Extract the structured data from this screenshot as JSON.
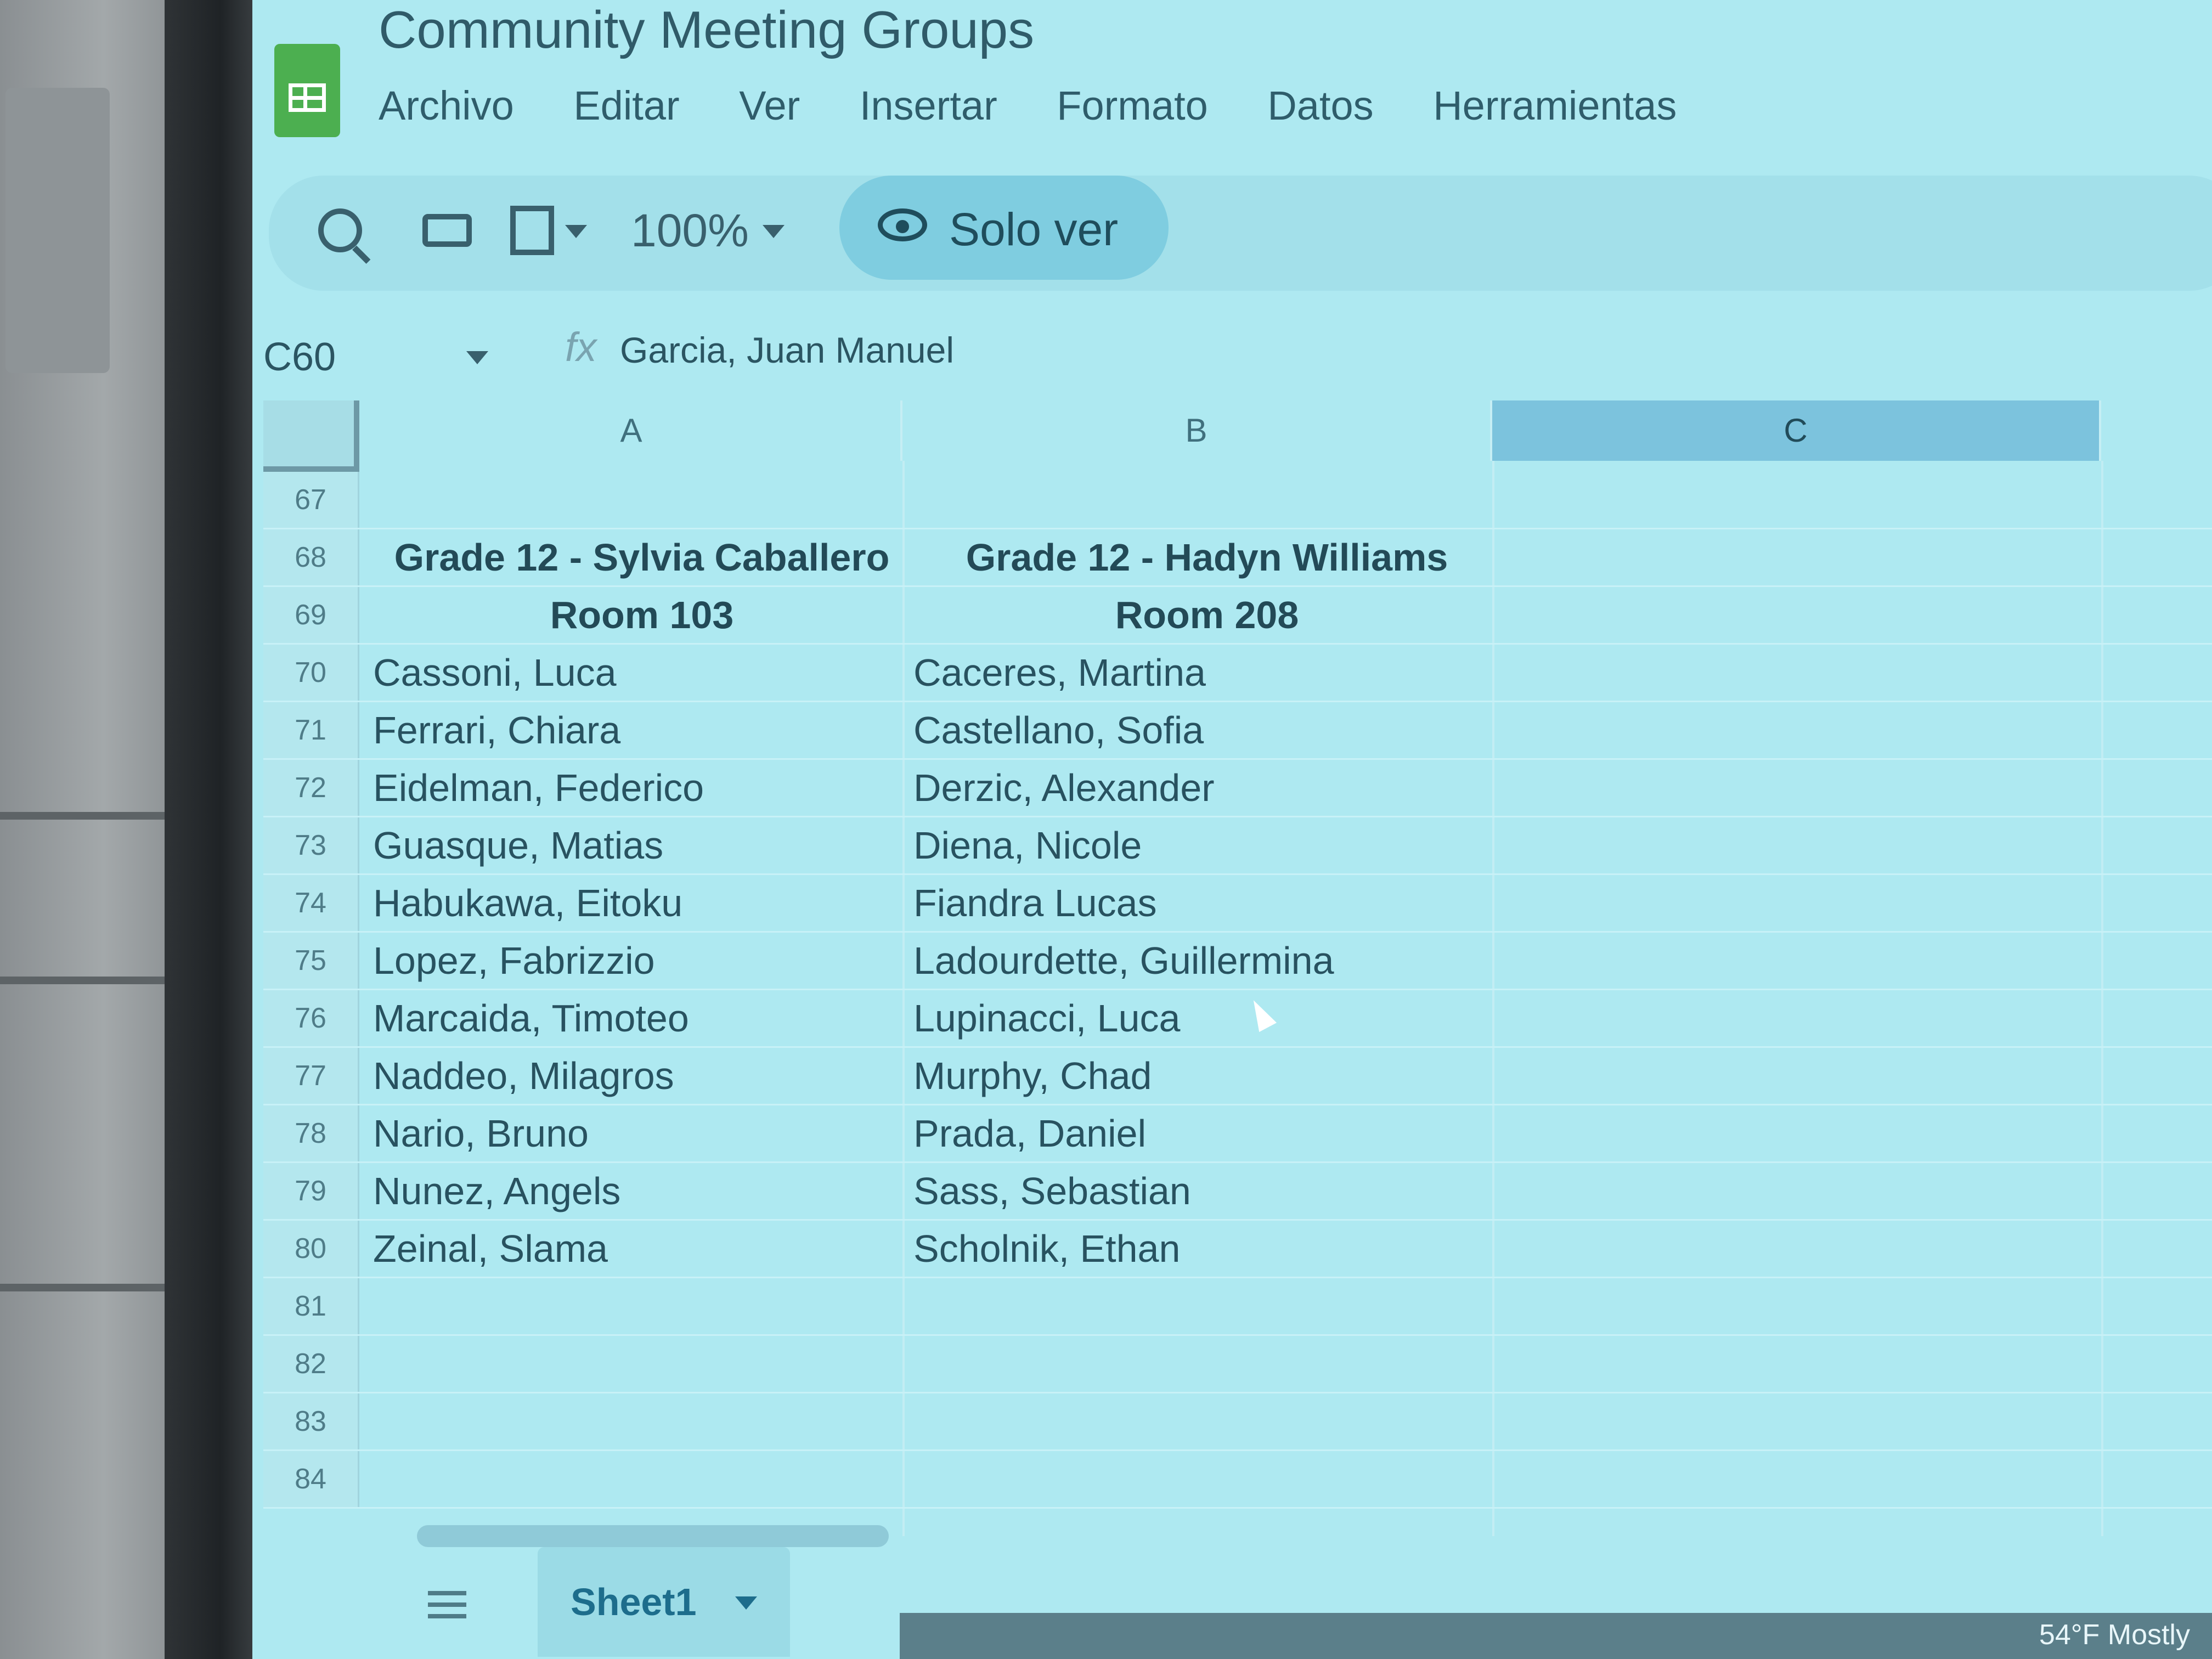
{
  "document": {
    "title": "Community Meeting Groups"
  },
  "menu": [
    "Archivo",
    "Editar",
    "Ver",
    "Insertar",
    "Formato",
    "Datos",
    "Herramientas"
  ],
  "toolbar": {
    "zoom": "100%",
    "view_mode": "Solo ver",
    "icons": [
      "search-icon",
      "print-icon",
      "format-paint-icon",
      "eye-icon"
    ]
  },
  "formula_bar": {
    "cell_ref": "C60",
    "fx": "fx",
    "value": "Garcia, Juan Manuel"
  },
  "columns": [
    "A",
    "B",
    "C"
  ],
  "rows": [
    {
      "num": "67",
      "a": "",
      "b": ""
    },
    {
      "num": "68",
      "a": "Grade 12 - Sylvia Caballero",
      "b": "Grade 12 - Hadyn Williams"
    },
    {
      "num": "69",
      "a": "Room 103",
      "b": "Room 208"
    },
    {
      "num": "70",
      "a": "Cassoni, Luca",
      "b": "Caceres, Martina"
    },
    {
      "num": "71",
      "a": "Ferrari, Chiara",
      "b": "Castellano, Sofia"
    },
    {
      "num": "72",
      "a": "Eidelman, Federico",
      "b": "Derzic, Alexander"
    },
    {
      "num": "73",
      "a": "Guasque, Matias",
      "b": "Diena, Nicole"
    },
    {
      "num": "74",
      "a": "Habukawa, Eitoku",
      "b": "Fiandra Lucas"
    },
    {
      "num": "75",
      "a": "Lopez, Fabrizzio",
      "b": "Ladourdette, Guillermina"
    },
    {
      "num": "76",
      "a": "Marcaida, Timoteo",
      "b": "Lupinacci, Luca"
    },
    {
      "num": "77",
      "a": "Naddeo, Milagros",
      "b": "Murphy, Chad"
    },
    {
      "num": "78",
      "a": "Nario, Bruno",
      "b": "Prada, Daniel"
    },
    {
      "num": "79",
      "a": "Nunez, Angels",
      "b": "Sass, Sebastian"
    },
    {
      "num": "80",
      "a": "Zeinal, Slama",
      "b": "Scholnik, Ethan"
    },
    {
      "num": "81",
      "a": "",
      "b": ""
    },
    {
      "num": "82",
      "a": "",
      "b": ""
    },
    {
      "num": "83",
      "a": "",
      "b": ""
    },
    {
      "num": "84",
      "a": "",
      "b": ""
    }
  ],
  "sheets": [
    {
      "name": "Sheet1"
    }
  ],
  "system": {
    "weather": "54°F Mostly"
  }
}
